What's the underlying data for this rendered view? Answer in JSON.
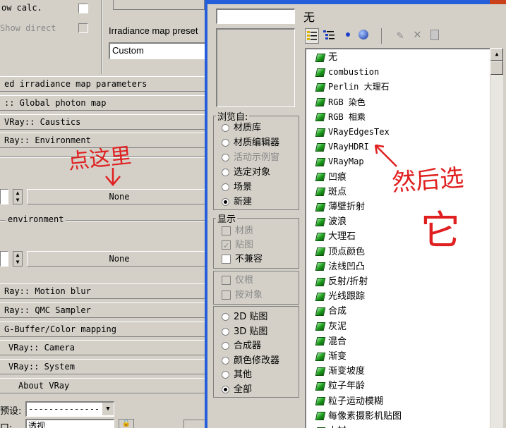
{
  "left_panel": {
    "top_checks": {
      "calc_label": "ow calc.",
      "show_direct_label": "Show direct"
    },
    "irradiance": {
      "preset_label": "Irradiance map preset",
      "preset_value": "Custom"
    },
    "rollouts": {
      "advanced_irradiance": "ed irradiance map parameters",
      "global_photon": ":: Global photon map",
      "caustics": "VRay:: Caustics",
      "environment": "Ray:: Environment"
    },
    "env_none_1": "None",
    "environment_group_label": "environment",
    "env_none_2": "None",
    "rollouts_lower": {
      "motion_blur": "Ray:: Motion blur",
      "qmc_sampler": "Ray:: QMC Sampler",
      "gbuffer": "G-Buffer/Color mapping",
      "camera": "VRay:: Camera",
      "system": "VRay:: System",
      "about": "About VRay"
    },
    "preset_row": {
      "label": "预设:",
      "value": "--------------"
    },
    "view_row": {
      "label": "口:",
      "value": "透视"
    }
  },
  "browser": {
    "search_value": "",
    "selected_name": "无",
    "toolbar": {
      "icons": [
        "list-view-icon",
        "tree-view-icon",
        "small-sphere-icon",
        "large-sphere-icon",
        "update-scene-icon",
        "delete-icon",
        "clear-icon"
      ]
    },
    "browse_from": {
      "legend": "浏览自:",
      "options": [
        {
          "label": "材质库",
          "selected": false,
          "disabled": false
        },
        {
          "label": "材质编辑器",
          "selected": false,
          "disabled": false
        },
        {
          "label": "活动示例窗",
          "selected": false,
          "disabled": true
        },
        {
          "label": "选定对象",
          "selected": false,
          "disabled": false
        },
        {
          "label": "场景",
          "selected": false,
          "disabled": false
        },
        {
          "label": "新建",
          "selected": true,
          "disabled": false
        }
      ]
    },
    "show": {
      "legend": "显示",
      "options": [
        {
          "label": "材质",
          "checked": false,
          "disabled": true
        },
        {
          "label": "贴图",
          "checked": true,
          "disabled": true
        },
        {
          "label": "不兼容",
          "checked": false,
          "disabled": false
        }
      ]
    },
    "root_options": [
      {
        "label": "仅根",
        "checked": false,
        "disabled": true
      },
      {
        "label": "按对象",
        "checked": false,
        "disabled": true
      }
    ],
    "map_types": {
      "options": [
        {
          "label": "2D 贴图",
          "selected": false
        },
        {
          "label": "3D 贴图",
          "selected": false
        },
        {
          "label": "合成器",
          "selected": false
        },
        {
          "label": "颜色修改器",
          "selected": false
        },
        {
          "label": "其他",
          "selected": false
        },
        {
          "label": "全部",
          "selected": true
        }
      ]
    },
    "map_list": [
      "无",
      "combustion",
      "Perlin 大理石",
      "RGB 染色",
      "RGB 相乘",
      "VRayEdgesTex",
      "VRayHDRI",
      "VRayMap",
      "凹痕",
      "斑点",
      "薄壁折射",
      "波浪",
      "大理石",
      "顶点颜色",
      "法线凹凸",
      "反射/折射",
      "光线跟踪",
      "合成",
      "灰泥",
      "混合",
      "渐变",
      "渐变坡度",
      "粒子年龄",
      "粒子运动模糊",
      "每像素摄影机贴图",
      "木材"
    ]
  },
  "annotations": {
    "click_here": "点这里",
    "then_choose": "然后选",
    "it": "它"
  },
  "colors": {
    "panel_bg": "#d4d0c8",
    "window_border": "#245edb",
    "annotation_red": "#e02020",
    "map_icon_green": "#1a9a1a"
  }
}
